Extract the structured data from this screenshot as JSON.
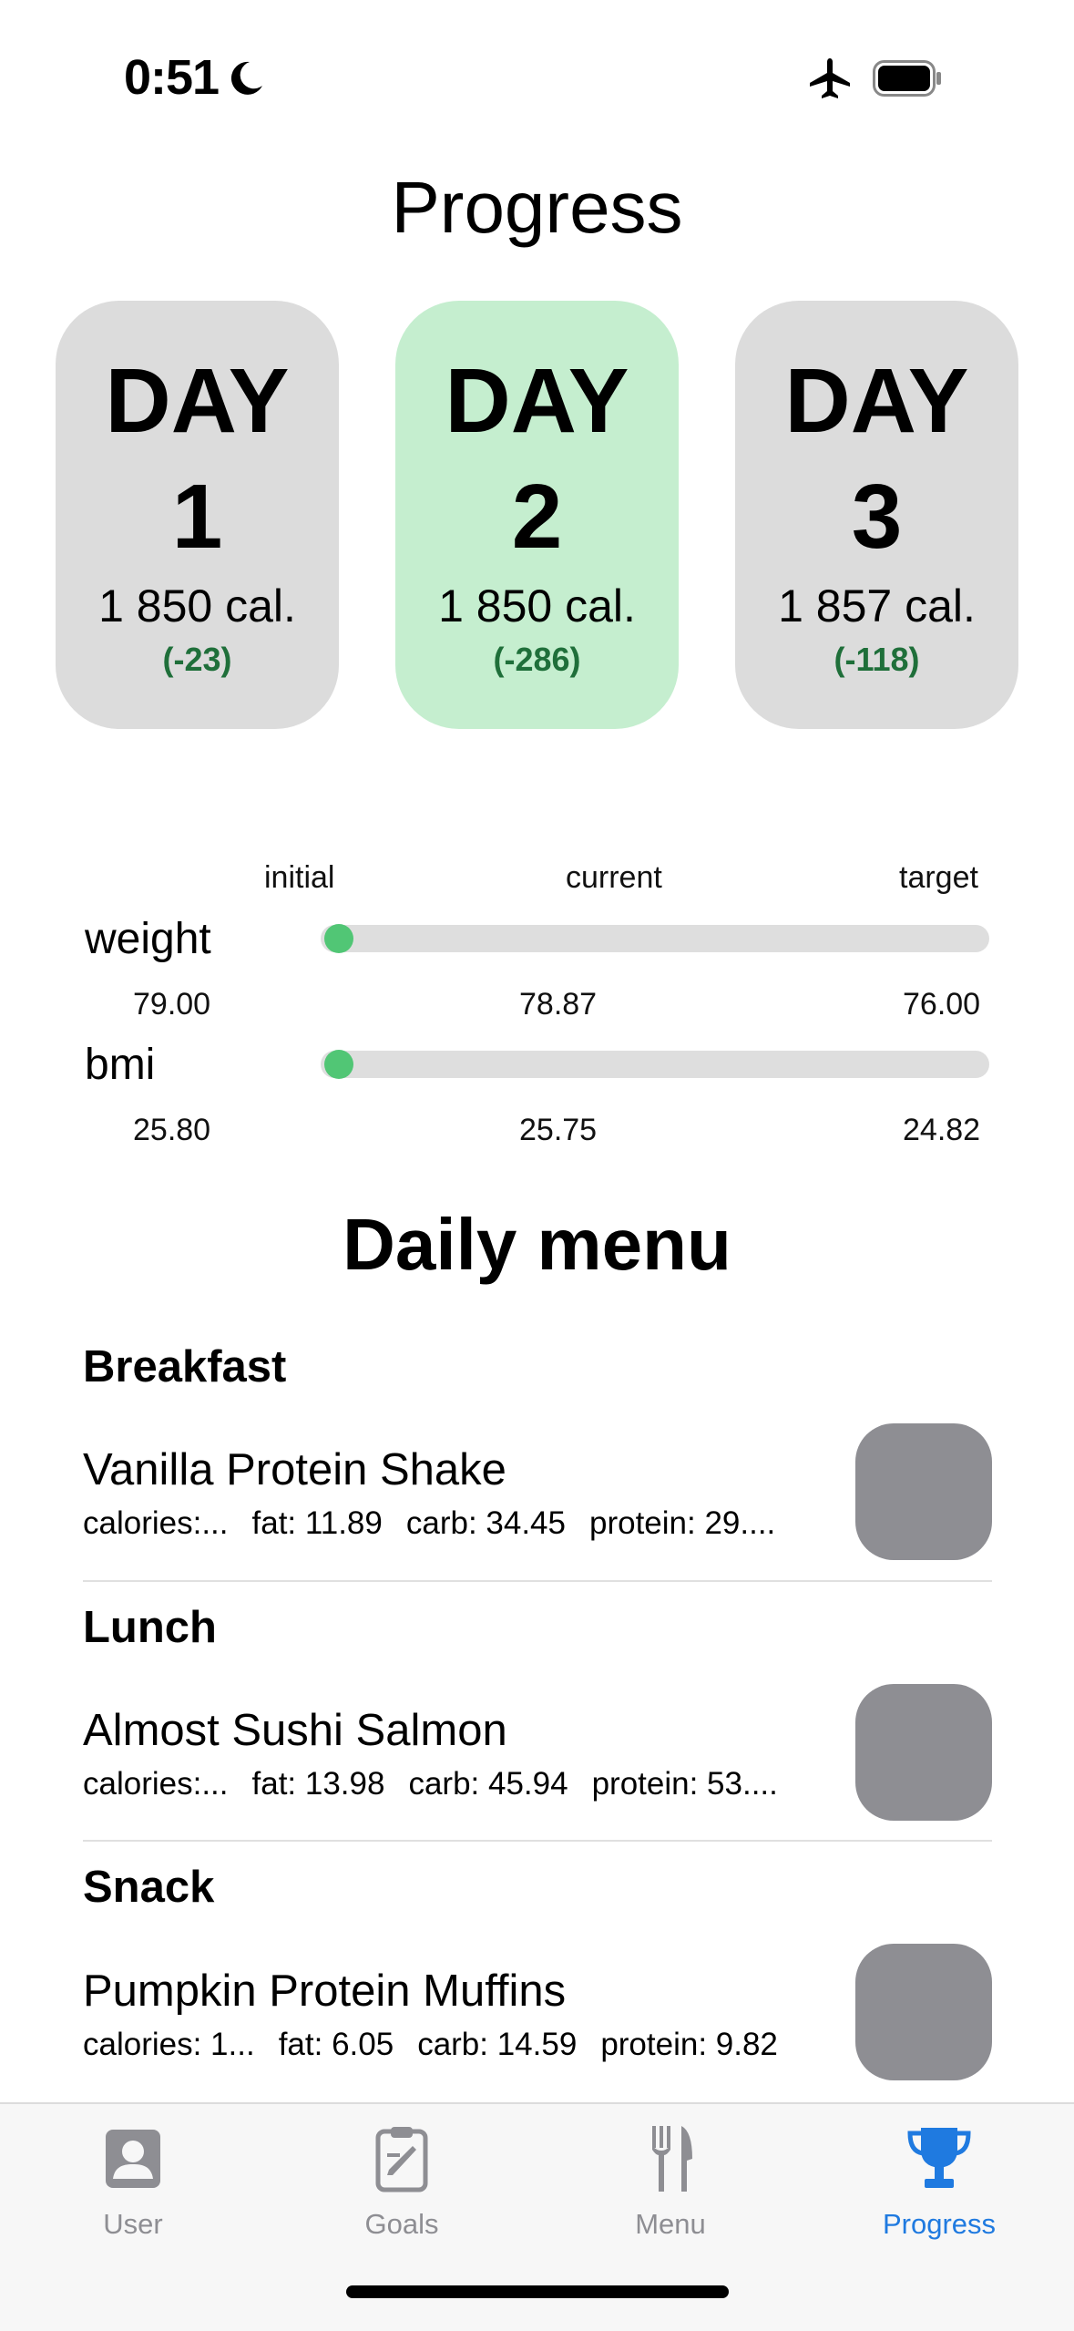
{
  "status": {
    "time": "0:51"
  },
  "title": "Progress",
  "days": [
    {
      "word": "DAY",
      "number": "1",
      "calories": "1 850 cal.",
      "diff": "(-23)"
    },
    {
      "word": "DAY",
      "number": "2",
      "calories": "1 850 cal.",
      "diff": "(-286)"
    },
    {
      "word": "DAY",
      "number": "3",
      "calories": "1 857 cal.",
      "diff": "(-118)"
    }
  ],
  "progress": {
    "headers": {
      "initial": "initial",
      "current": "current",
      "target": "target"
    },
    "weight": {
      "label": "weight",
      "initial": "79.00",
      "current": "78.87",
      "target": "76.00",
      "progress_fraction": 0.043
    },
    "bmi": {
      "label": "bmi",
      "initial": "25.80",
      "current": "25.75",
      "target": "24.82",
      "progress_fraction": 0.051
    }
  },
  "menu": {
    "title": "Daily menu",
    "meals": [
      {
        "category": "Breakfast",
        "name": "Vanilla Protein Shake",
        "calories": "calories:...",
        "fat": "fat: 11.89",
        "carb": "carb: 34.45",
        "protein": "protein: 29...."
      },
      {
        "category": "Lunch",
        "name": "Almost Sushi Salmon",
        "calories": "calories:...",
        "fat": "fat: 13.98",
        "carb": "carb: 45.94",
        "protein": "protein: 53...."
      },
      {
        "category": "Snack",
        "name": "Pumpkin Protein Muffins",
        "calories": "calories: 1...",
        "fat": "fat: 6.05",
        "carb": "carb: 14.59",
        "protein": "protein: 9.82"
      }
    ]
  },
  "tabs": [
    {
      "label": "User",
      "icon": "user-icon"
    },
    {
      "label": "Goals",
      "icon": "clipboard-icon"
    },
    {
      "label": "Menu",
      "icon": "fork-knife-icon"
    },
    {
      "label": "Progress",
      "icon": "trophy-icon",
      "active": true
    }
  ],
  "colors": {
    "accent": "#1f7ae0",
    "progress_dot": "#51c675",
    "active_day": "#c5eecf",
    "diff_text": "#1f6f3a"
  }
}
